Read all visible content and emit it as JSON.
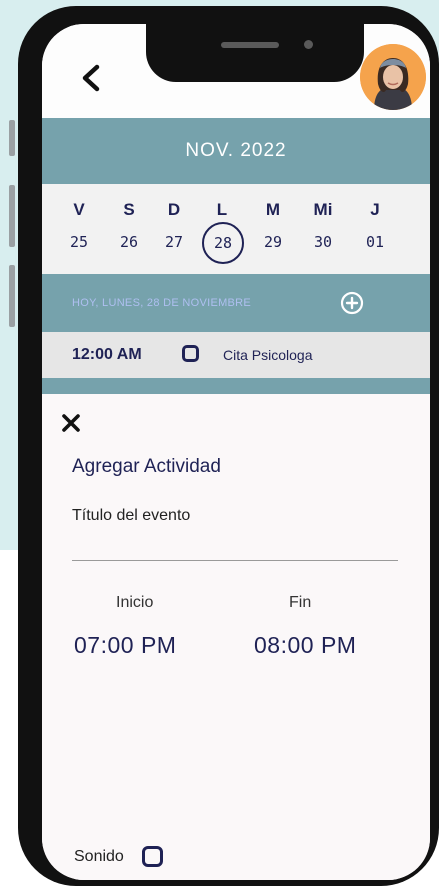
{
  "header": {
    "back_icon": "chevron-left-icon",
    "avatar_icon": "user-avatar"
  },
  "calendar": {
    "month_label": "NOV. 2022",
    "days": [
      {
        "name": "V",
        "date": "25"
      },
      {
        "name": "S",
        "date": "26"
      },
      {
        "name": "D",
        "date": "27"
      },
      {
        "name": "L",
        "date": "28",
        "selected": true
      },
      {
        "name": "M",
        "date": "29"
      },
      {
        "name": "Mi",
        "date": "30"
      },
      {
        "name": "J",
        "date": "01"
      }
    ],
    "today_label": "HOY, LUNES, 28 DE NOVIEMBRE",
    "add_icon": "plus-circle-icon"
  },
  "events": [
    {
      "time": "12:00 AM",
      "title": "Cita Psicologa",
      "checked": false
    }
  ],
  "add_activity": {
    "close_icon": "close-icon",
    "title": "Agregar Actividad",
    "event_title_label": "Título del evento",
    "event_title_value": "",
    "start_label": "Inicio",
    "start_time": "07:00 PM",
    "end_label": "Fin",
    "end_time": "08:00 PM",
    "sound_label": "Sonido",
    "sound_checked": false
  },
  "colors": {
    "accent": "#76a2ac",
    "text_primary": "#1f2255",
    "background_tint": "#d8eeef"
  }
}
